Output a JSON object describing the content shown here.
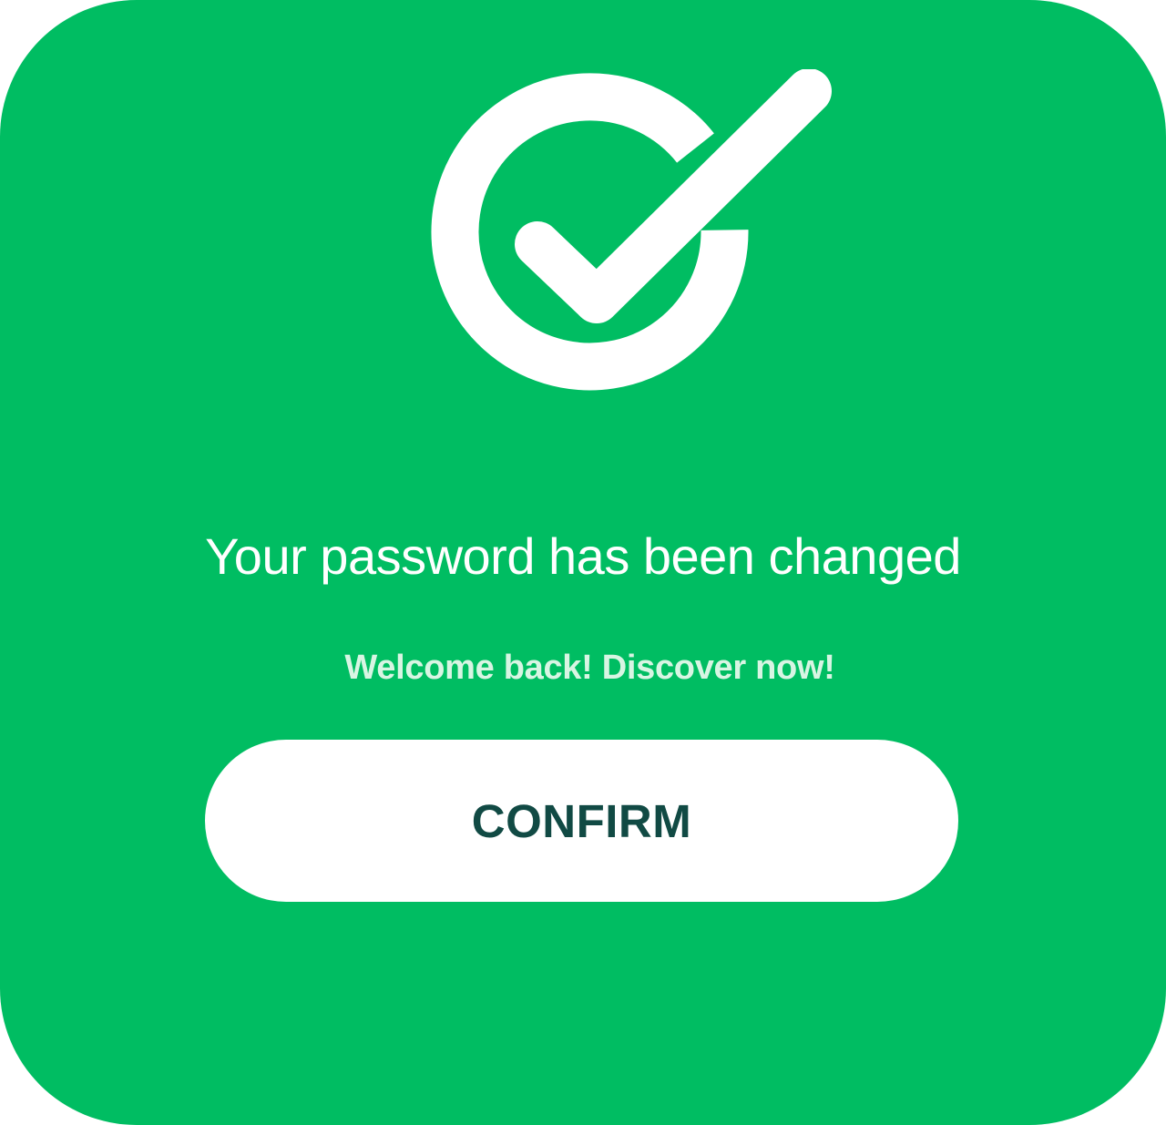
{
  "dialog": {
    "icon": "check-circle-icon",
    "title": "Your password has been changed",
    "subtitle": "Welcome back! Discover now!",
    "confirm_label": "CONFIRM"
  },
  "colors": {
    "background": "#00bd62",
    "icon": "#ffffff",
    "title": "#ffffff",
    "subtitle": "#d8f5e3",
    "button_background": "#ffffff",
    "button_text": "#114a44"
  }
}
